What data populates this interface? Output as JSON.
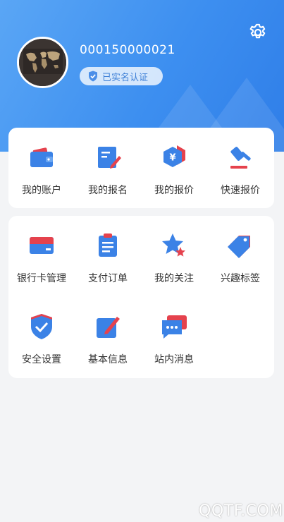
{
  "profile": {
    "phone": "000150000021",
    "verified_label": "已实名认证"
  },
  "colors": {
    "header_blue": "#3d8ff0",
    "icon_blue": "#3b82e6",
    "icon_red": "#e5424d"
  },
  "section1": [
    {
      "label": "我的账户",
      "icon": "wallet-icon"
    },
    {
      "label": "我的报名",
      "icon": "edit-form-icon"
    },
    {
      "label": "我的报价",
      "icon": "yuan-hexagon-icon"
    },
    {
      "label": "快速报价",
      "icon": "gavel-icon"
    }
  ],
  "section2": [
    {
      "label": "银行卡管理",
      "icon": "bank-card-icon"
    },
    {
      "label": "支付订单",
      "icon": "clipboard-order-icon"
    },
    {
      "label": "我的关注",
      "icon": "star-icon"
    },
    {
      "label": "兴趣标签",
      "icon": "tag-icon"
    },
    {
      "label": "安全设置",
      "icon": "shield-check-icon"
    },
    {
      "label": "基本信息",
      "icon": "edit-info-icon"
    },
    {
      "label": "站内消息",
      "icon": "message-icon"
    }
  ],
  "watermark": "QQTF.COM"
}
